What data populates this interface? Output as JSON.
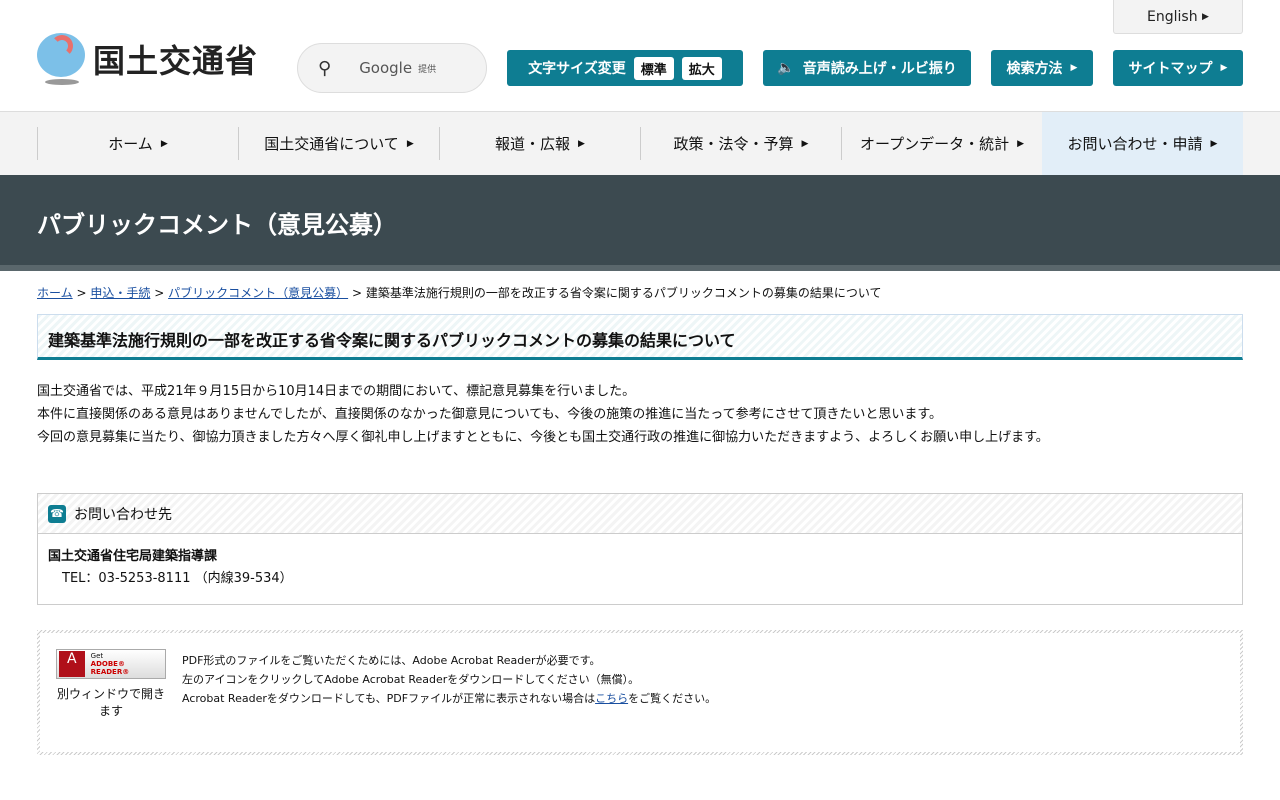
{
  "header": {
    "logo_text": "国土交通省",
    "search_brand": "Google",
    "search_suffix": "提供",
    "english": "English",
    "font_size_label": "文字サイズ変更",
    "font_standard": "標準",
    "font_large": "拡大",
    "speech": "音声読み上げ・ルビ振り",
    "search_method": "検索方法",
    "sitemap": "サイトマップ"
  },
  "nav": [
    "ホーム",
    "国土交通省について",
    "報道・広報",
    "政策・法令・予算",
    "オープンデータ・統計",
    "お問い合わせ・申請"
  ],
  "banner": "パブリックコメント（意見公募）",
  "breadcrumb": {
    "items": [
      "ホーム",
      "申込・手続",
      "パブリックコメント（意見公募）"
    ],
    "current": "建築基準法施行規則の一部を改正する省令案に関するパブリックコメントの募集の結果について",
    "sep": ">"
  },
  "title": "建築基準法施行規則の一部を改正する省令案に関するパブリックコメントの募集の結果について",
  "body": [
    "国土交通省では、平成21年９月15日から10月14日までの期間において、標記意見募集を行いました。",
    "本件に直接関係のある意見はありませんでしたが、直接関係のなかった御意見についても、今後の施策の推進に当たって参考にさせて頂きたいと思います。",
    "今回の意見募集に当たり、御協力頂きました方々へ厚く御礼申し上げますとともに、今後とも国土交通行政の推進に御協力いただきますよう、よろしくお願い申し上げます。"
  ],
  "contact": {
    "heading": "お問い合わせ先",
    "org": "国土交通省住宅局建築指導課",
    "tel": "TEL：03-5253-8111 （内線39-534）"
  },
  "pdf": {
    "badge_get": "Get",
    "badge_reader": "ADOBE® READER®",
    "window_note": "別ウィンドウで開きます",
    "line1": "PDF形式のファイルをご覧いただくためには、Adobe Acrobat Readerが必要です。",
    "line2": "左のアイコンをクリックしてAdobe Acrobat Readerをダウンロードしてください（無償）。",
    "line3_pre": "Acrobat Readerをダウンロードしても、PDFファイルが正常に表示されない場合は",
    "line3_link": "こちら",
    "line3_post": "をご覧ください。"
  }
}
